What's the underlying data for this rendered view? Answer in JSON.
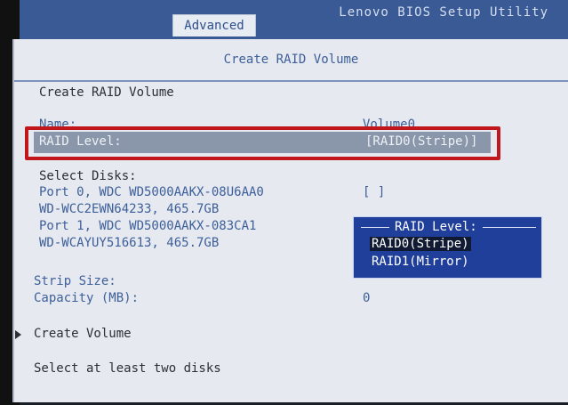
{
  "header": {
    "utility_title": "Lenovo BIOS Setup Utility",
    "active_tab": "Advanced"
  },
  "panel": {
    "title": "Create RAID Volume",
    "section_title": "Create RAID Volume",
    "name_label": "Name:",
    "name_value": "Volume0",
    "raid_level_label": "RAID Level:",
    "raid_level_value": "[RAID0(Stripe)]",
    "select_disks_label": "Select Disks:",
    "disks": [
      {
        "line1": "Port 0, WDC WD5000AAKX-08U6AA0",
        "line2": "WD-WCC2EWN64233, 465.7GB",
        "checkbox": "[ ]"
      },
      {
        "line1": "Port 1, WDC WD5000AAKX-083CA1",
        "line2": "WD-WCAYUY516613, 465.7GB",
        "checkbox": ""
      }
    ],
    "strip_size_label": "Strip Size:",
    "capacity_label": "Capacity (MB):",
    "capacity_value": "0",
    "create_volume_label": "Create Volume",
    "status_message": "Select at least two disks"
  },
  "popup": {
    "title": "RAID Level:",
    "options": [
      "RAID0(Stripe)",
      "RAID1(Mirror)"
    ],
    "selected_index": 0
  },
  "colors": {
    "accent_blue": "#3d5f9a",
    "popup_bg": "#1f3f9a",
    "highlight_red": "#c0161c"
  }
}
